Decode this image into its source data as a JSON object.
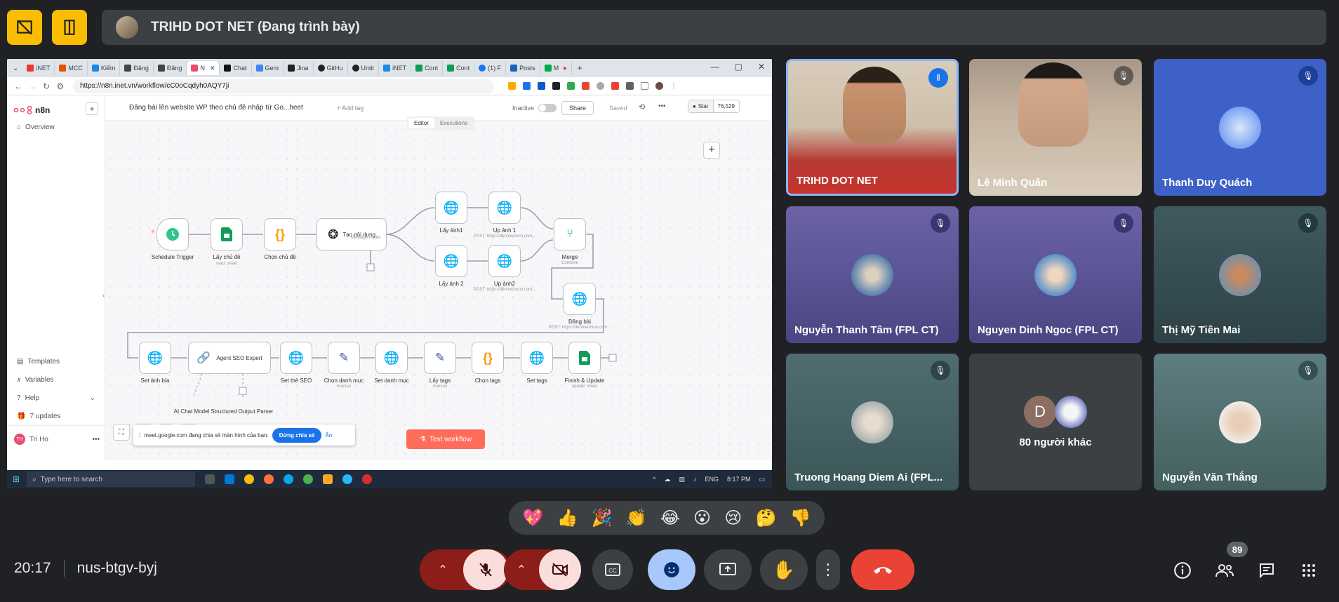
{
  "meet": {
    "presenter_bar_text": "TRIHD DOT NET (Đang trình bày)",
    "meeting_time": "20:17",
    "meeting_code": "nus-btgv-byj",
    "participant_count_badge": "89",
    "others_label": "80 người khác",
    "reactions": [
      "💖",
      "👍",
      "🎉",
      "👏",
      "😂",
      "😮",
      "😢",
      "🤔",
      "👎"
    ],
    "accent_colors": {
      "yellow": "#fbbc04",
      "end_call": "#ea4335",
      "muted_bg": "#f9dedc",
      "active_blue": "#a8c7fa"
    }
  },
  "participants": [
    {
      "name": "TRIHD DOT NET"
    },
    {
      "name": "Lê Minh Quân"
    },
    {
      "name": "Thanh Duy Quách"
    },
    {
      "name": "Nguyễn Thanh Tâm (FPL CT)"
    },
    {
      "name": "Nguyen Dinh Ngoc (FPL CT)"
    },
    {
      "name": "Thị Mỹ Tiên Mai"
    },
    {
      "name": "Truong Hoang Diem Ai (FPL..."
    },
    {
      "name": "Nguyễn Văn Thắng"
    }
  ],
  "others_avatar_letter": "D",
  "browser": {
    "tabs": [
      "iNET",
      "MCC",
      "Kiểm",
      "Đăng",
      "Đăng",
      "N",
      "Chat",
      "Gem",
      "Jina",
      "GitHu",
      "Untit",
      "iNET",
      "Cont",
      "Cont",
      "(1) F",
      "Posts",
      "M"
    ],
    "url": "https://n8n.inet.vn/workflow/cC0oCqdyh0AQY7ji"
  },
  "n8n": {
    "brand": "n8n",
    "overview": "Overview",
    "sidebar_bottom": [
      "Templates",
      "Variables",
      "Help",
      "7 updates"
    ],
    "user": "Tri Ho",
    "user_initials": "TH",
    "workflow_title": "Đăng bài lên website WP theo chủ đề nhập từ Go...heet",
    "add_tag": "+ Add tag",
    "inactive": "Inactive",
    "share": "Share",
    "saved": "Saved",
    "star": "Star",
    "star_count": "76,529",
    "tab_editor": "Editor",
    "tab_executions": "Executions",
    "test_workflow": "Test workflow",
    "nodes": {
      "schedule": "Schedule Trigger",
      "laychude": "Lấy chủ đề",
      "laychude_sub": "read: sheet",
      "chonchude": "Chọn chủ đề",
      "taonoidung": "Tạo nội dung",
      "taonoidung_sub": "Message Model",
      "layanh1": "Lấy ảnh1",
      "upanh1": "Up ảnh 1",
      "upanh1_sub": "POST: https://denmeorxon.com...",
      "layanh2": "Lấy ảnh 2",
      "upanh2": "Up ảnh2",
      "upanh2_sub": "POST: https://denmeorxon.com...",
      "merge": "Merge",
      "merge_sub": "Combine",
      "dangbai": "Đăng bài",
      "dangbai_sub": "POST: https://denmeorxon.com...",
      "setanhbia": "Set ảnh bìa",
      "agent": "Agent SEO Expert",
      "setthe": "Set thẻ SEO",
      "chondanhmuc": "Chọn danh mục",
      "chondanhmuc_sub": "manual",
      "setdanhmuc": "Set danh mục",
      "laytags": "Lấy tags",
      "laytags_sub": "manual",
      "chontags": "Chọn tags",
      "settags": "Set tags",
      "finish": "Finish & Update",
      "finish_sub": "update: sheet",
      "aichat": "AI Chat Model",
      "structured": "Structured Output Parser"
    },
    "share_notice": "meet.google.com đang chia sẻ màn hình của bạn.",
    "stop_share": "Dừng chia sẻ",
    "hide": "Ẩn"
  },
  "taskbar": {
    "search_placeholder": "Type here to search",
    "time": "8:17 PM",
    "lang": "ENG"
  }
}
